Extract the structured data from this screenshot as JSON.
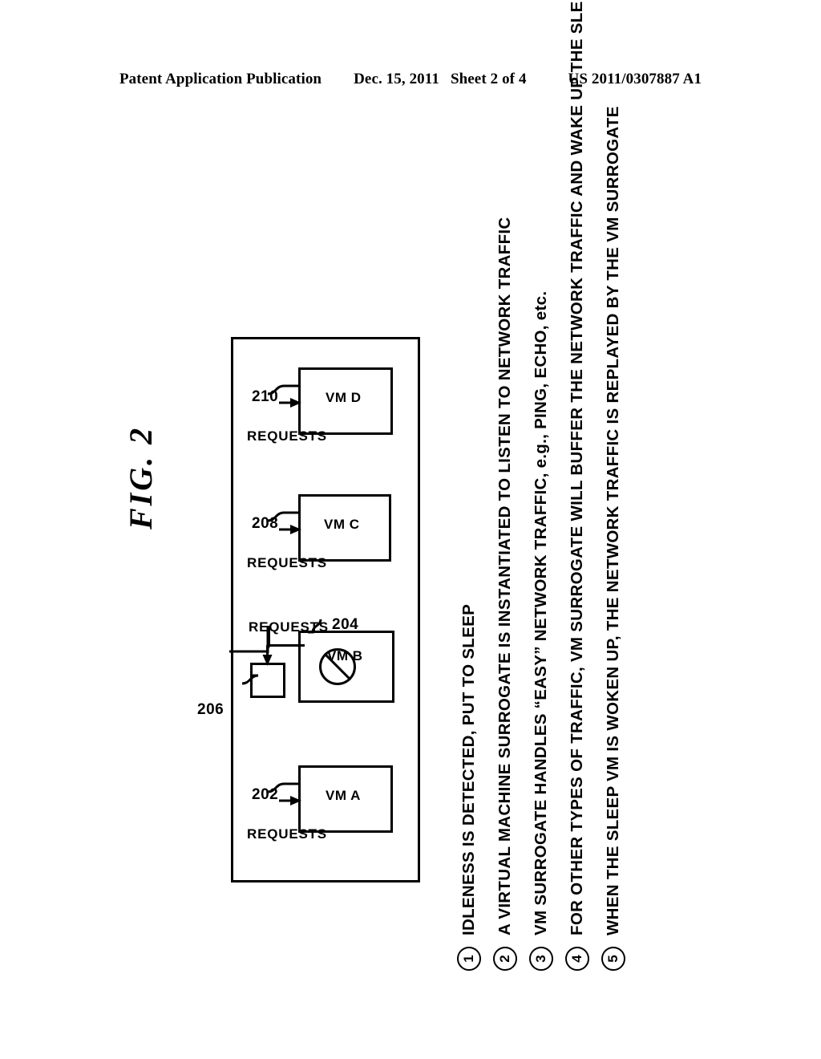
{
  "header": {
    "publication": "Patent Application Publication",
    "date": "Dec. 15, 2011",
    "sheet": "Sheet 2 of 4",
    "number": "US 2011/0307887 A1"
  },
  "figure": {
    "label": "FIG. 2"
  },
  "diagram": {
    "nodes": [
      {
        "id": "vm-a",
        "name": "VM A",
        "ref": "202",
        "requests_label": "REQUESTS",
        "sleeping": false,
        "has_surrogate": false
      },
      {
        "id": "vm-b",
        "name": "VM B",
        "ref": "204",
        "requests_label": "REQUESTS",
        "sleeping": true,
        "has_surrogate": true,
        "surrogate_ref": "206"
      },
      {
        "id": "vm-c",
        "name": "VM C",
        "ref": "208",
        "requests_label": "REQUESTS",
        "sleeping": false,
        "has_surrogate": false
      },
      {
        "id": "vm-d",
        "name": "VM D",
        "ref": "210",
        "requests_label": "REQUESTS",
        "sleeping": false,
        "has_surrogate": false
      }
    ]
  },
  "legend": {
    "items": [
      {
        "number": "1",
        "text": "IDLENESS IS DETECTED, PUT TO SLEEP"
      },
      {
        "number": "2",
        "text": "A VIRTUAL MACHINE SURROGATE IS INSTANTIATED TO LISTEN TO NETWORK TRAFFIC"
      },
      {
        "number": "3",
        "text": "VM SURROGATE HANDLES “EASY” NETWORK TRAFFIC, e.g., PING, ECHO, etc."
      },
      {
        "number": "4",
        "text": "FOR OTHER TYPES OF TRAFFIC, VM SURROGATE WILL BUFFER THE NETWORK TRAFFIC AND WAKE UP THE SLEEPING VM"
      },
      {
        "number": "5",
        "text": "WHEN THE SLEEP VM IS WOKEN UP, THE NETWORK TRAFFIC IS REPLAYED BY THE VM SURROGATE"
      }
    ]
  },
  "colors": {
    "ink": "#000000",
    "paper": "#ffffff"
  }
}
